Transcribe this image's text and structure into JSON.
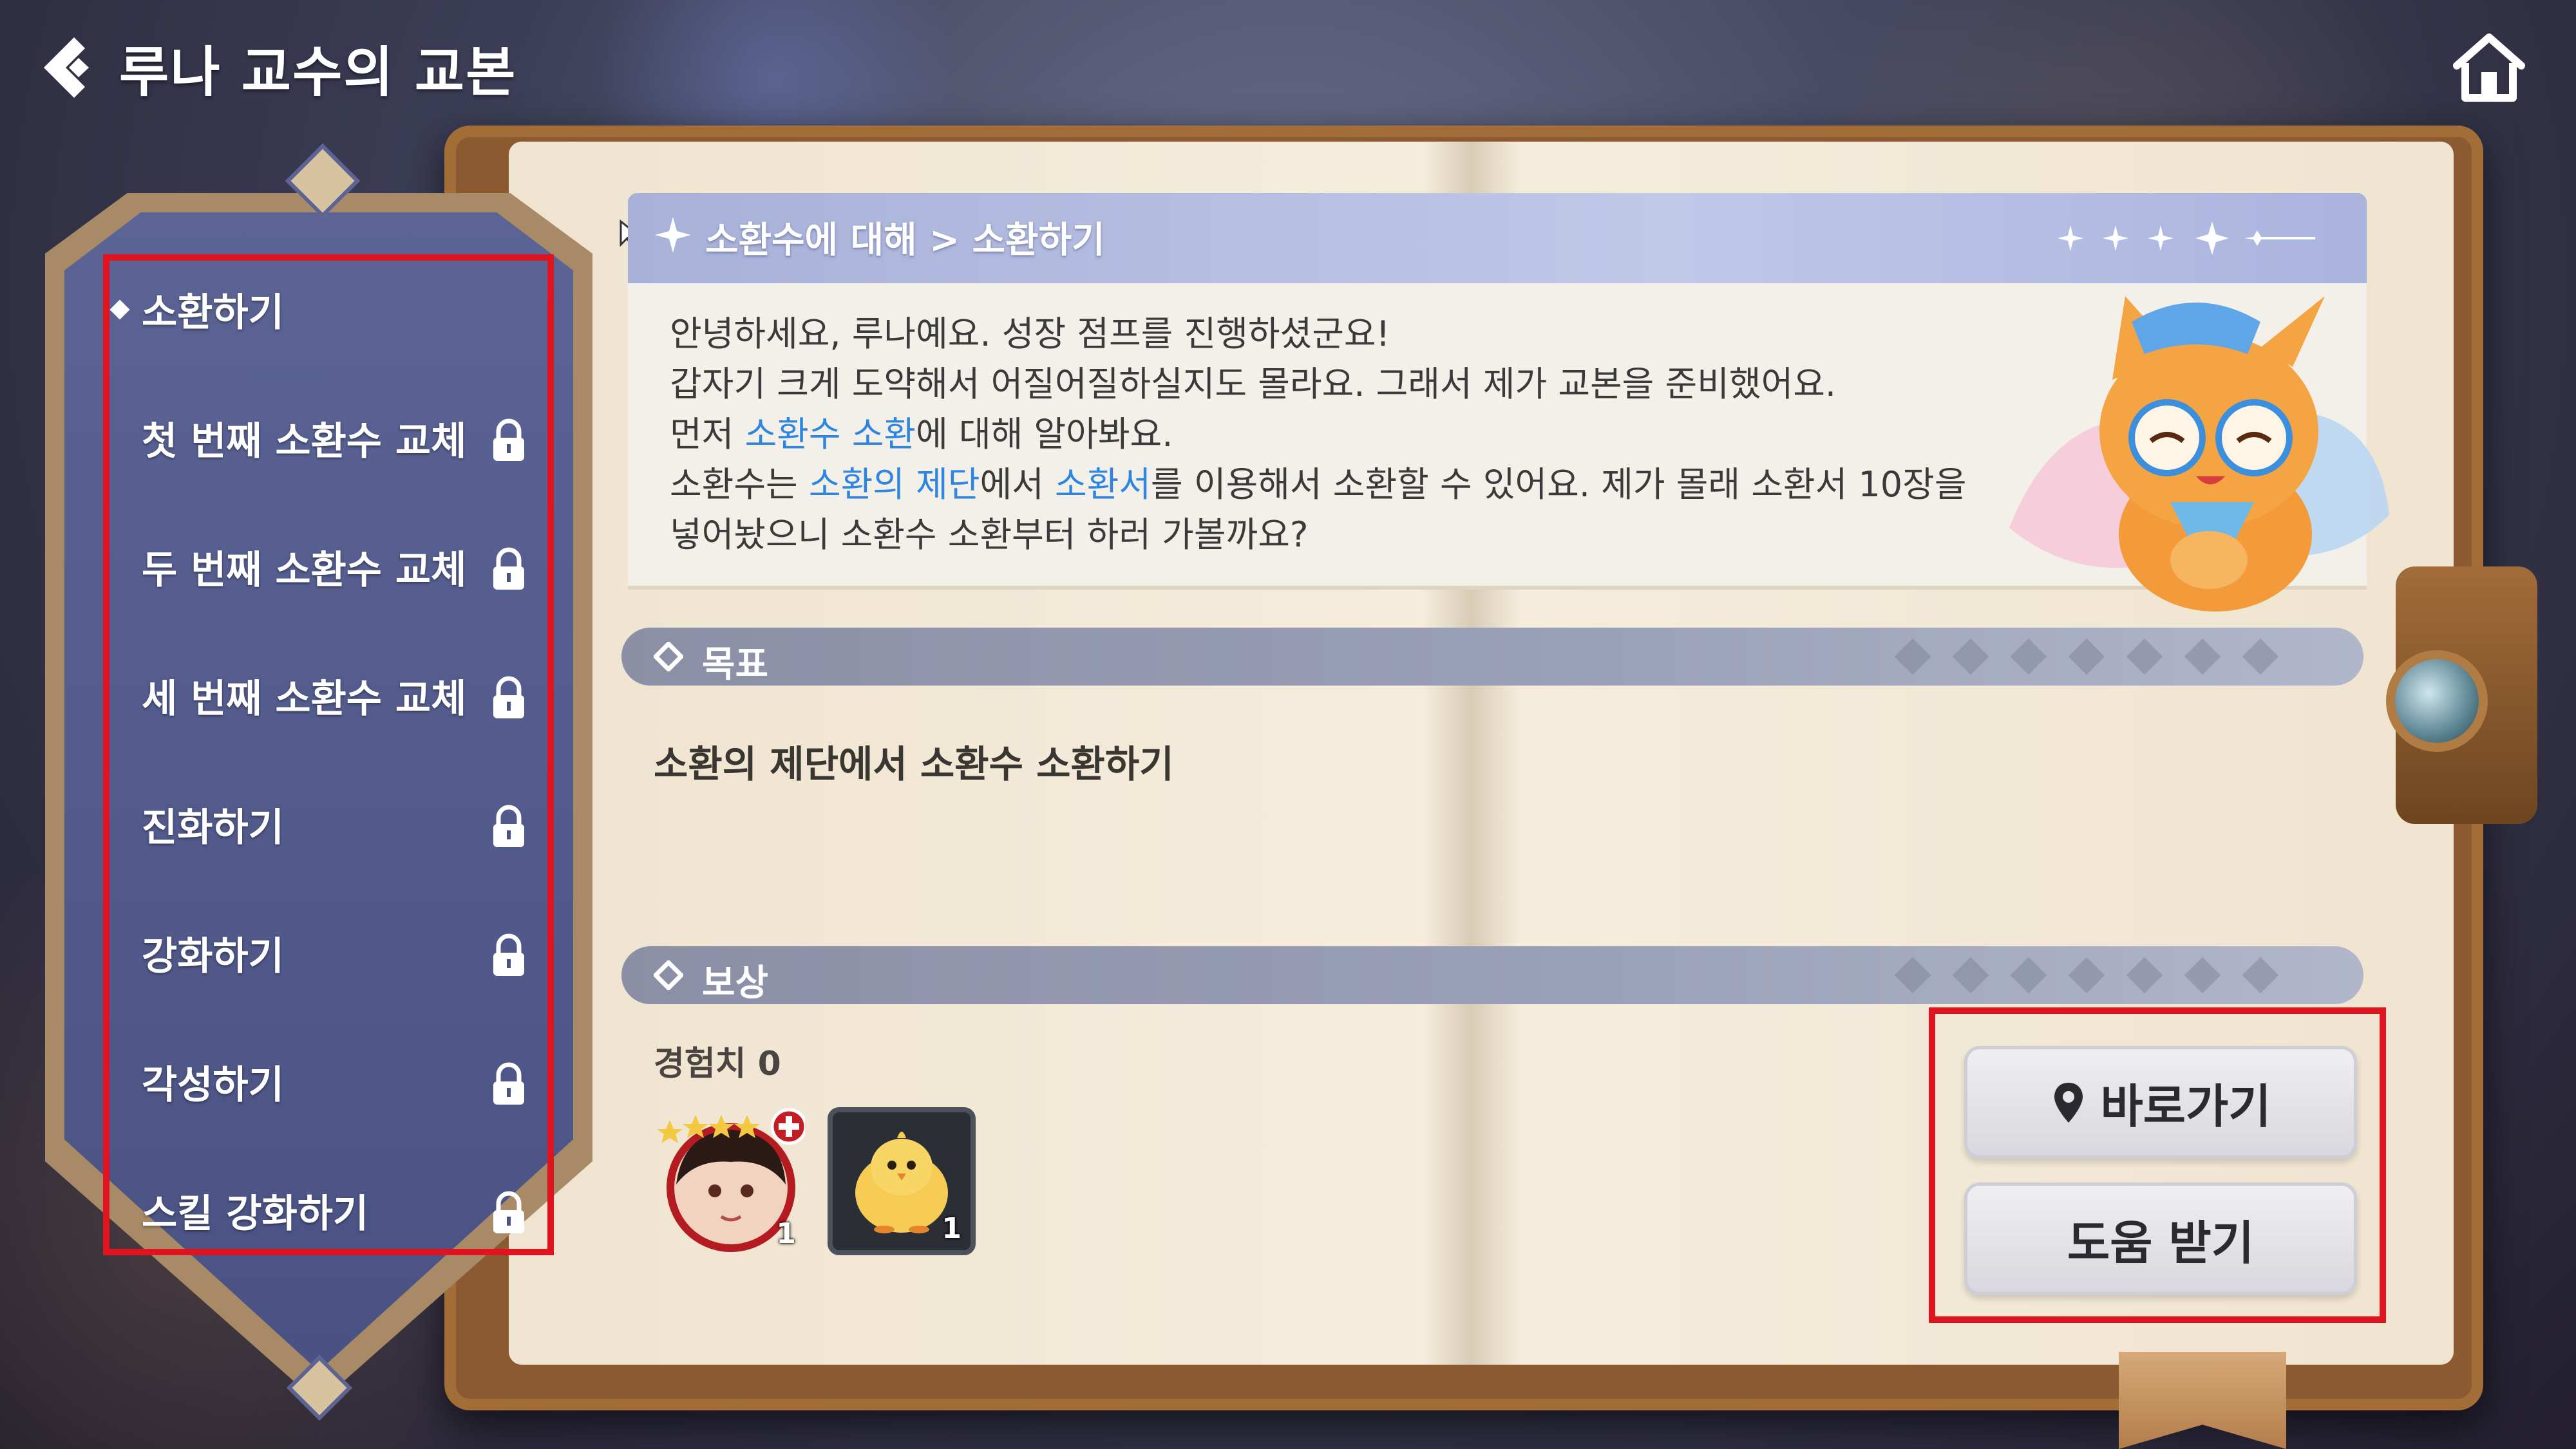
{
  "header": {
    "title": "루나 교수의 교본"
  },
  "sidebar": {
    "items": [
      {
        "label": "소환하기",
        "locked": false,
        "active": true
      },
      {
        "label": "첫 번째 소환수 교체",
        "locked": true,
        "active": false
      },
      {
        "label": "두 번째 소환수 교체",
        "locked": true,
        "active": false
      },
      {
        "label": "세 번째 소환수 교체",
        "locked": true,
        "active": false
      },
      {
        "label": "진화하기",
        "locked": true,
        "active": false
      },
      {
        "label": "강화하기",
        "locked": true,
        "active": false
      },
      {
        "label": "각성하기",
        "locked": true,
        "active": false
      },
      {
        "label": "스킬 강화하기",
        "locked": true,
        "active": false
      }
    ]
  },
  "intro": {
    "breadcrumb": "소환수에 대해 > 소환하기",
    "line1": "안녕하세요, 루나예요. 성장 점프를 진행하셨군요!",
    "line2": "갑자기 크게 도약해서 어질어질하실지도 몰라요. 그래서 제가 교본을 준비했어요.",
    "line3_a": "먼저 ",
    "line3_link": "소환수 소환",
    "line3_b": "에 대해 알아봐요.",
    "line4_a": "소환수는 ",
    "line4_link1": "소환의 제단",
    "line4_b": "에서 ",
    "line4_link2": "소환서",
    "line4_c": "를 이용해서 소환할 수 있어요. 제가 몰래 소환서 10장을",
    "line5": "넣어놨으니 소환수 소환부터 하러 가볼까요?"
  },
  "goal": {
    "title": "목표",
    "text": "소환의 제단에서 소환수 소환하기"
  },
  "reward": {
    "title": "보상",
    "exp_label": "경험치 0",
    "items": [
      {
        "icon": "hero-portrait-icon",
        "count": "1"
      },
      {
        "icon": "chick-icon",
        "count": "1"
      }
    ]
  },
  "actions": {
    "goto_label": "바로가기",
    "help_label": "도움 받기"
  },
  "colors": {
    "highlight": "#2f86e0",
    "sidebar": "#4a5284",
    "annotation_box": "#e0141e"
  }
}
